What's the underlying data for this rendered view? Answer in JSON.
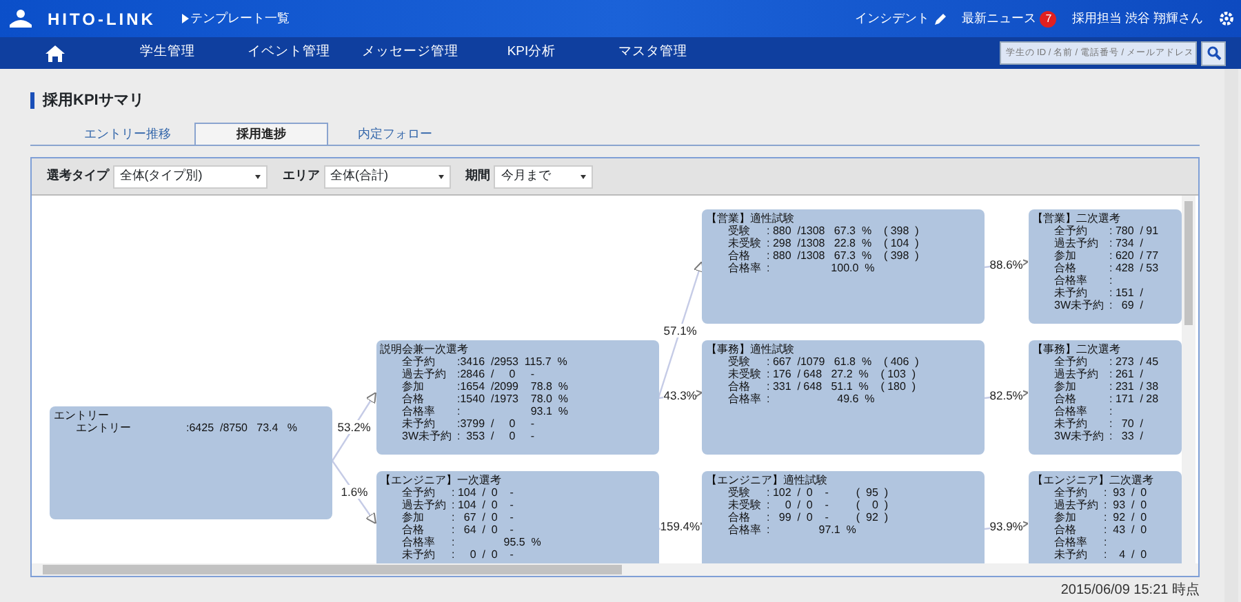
{
  "header": {
    "logo": "HITO-LINK",
    "template_link": "テンプレート一覧",
    "incident": "インシデント",
    "news": "最新ニュース",
    "news_count": "7",
    "user": "採用担当 渋谷 翔輝さん"
  },
  "nav": {
    "items": [
      {
        "label": "学生管理"
      },
      {
        "label": "イベント管理"
      },
      {
        "label": "メッセージ管理"
      },
      {
        "label": "KPI分析"
      },
      {
        "label": "マスタ管理"
      }
    ],
    "search_placeholder": "学生の ID / 名前 / 電話番号 / メールアドレス"
  },
  "page_title": "採用KPIサマリ",
  "tabs": [
    {
      "label": "エントリー推移",
      "selected": false
    },
    {
      "label": "採用進捗",
      "selected": true
    },
    {
      "label": "内定フォロー",
      "selected": false
    }
  ],
  "filters": [
    {
      "label": "選考タイプ",
      "value": "全体(タイプ別)"
    },
    {
      "label": "エリア",
      "value": "全体(合計)"
    },
    {
      "label": "期間",
      "value": "今月まで"
    }
  ],
  "flow": {
    "title": "エントリー",
    "rows": [
      {
        "label": "エントリー",
        "value": ":6425  /8750   73.4   %"
      }
    ],
    "children": [
      {
        "rate": "53.2%",
        "title": "説明会兼一次選考",
        "rows": [
          {
            "label": "全予約",
            "value": ":3416  /2953  115.7  %"
          },
          {
            "label": "過去予約",
            "value": ":2846  /     0     -"
          },
          {
            "label": "参加",
            "value": ":1654  /2099    78.8  %"
          },
          {
            "label": "合格",
            "value": ":1540  /1973    78.0  %"
          },
          {
            "label": "合格率",
            "value": ":                       93.1  %"
          },
          {
            "label": "未予約",
            "value": ":3799  /     0     -"
          },
          {
            "label": "3W未予約",
            "value": ":  353  /     0     -"
          }
        ],
        "children": [
          {
            "rate": "57.1%",
            "title": "【営業】適性試験",
            "rows": [
              {
                "label": "受験",
                "value": ": 880  /1308   67.3  %    ( 398  )"
              },
              {
                "label": "未受験",
                "value": ": 298  /1308   22.8  %    ( 104  )"
              },
              {
                "label": "合格",
                "value": ": 880  /1308   67.3  %    ( 398  )"
              },
              {
                "label": "合格率",
                "value": ":                    100.0  %"
              }
            ],
            "children": [
              {
                "rate": "88.6%",
                "title": "【営業】二次選考",
                "rows": [
                  {
                    "label": "全予約",
                    "value": ": 780  / 91"
                  },
                  {
                    "label": "過去予約",
                    "value": ": 734  /"
                  },
                  {
                    "label": "参加",
                    "value": ": 620  / 77"
                  },
                  {
                    "label": "合格",
                    "value": ": 428  / 53"
                  },
                  {
                    "label": "合格率",
                    "value": ":"
                  },
                  {
                    "label": "未予約",
                    "value": ": 151  /"
                  },
                  {
                    "label": "3W未予約",
                    "value": ":   69  /"
                  }
                ]
              }
            ]
          },
          {
            "rate": "43.3%",
            "title": "【事務】適性試験",
            "rows": [
              {
                "label": "受験",
                "value": ": 667  /1079   61.8  %    ( 406  )"
              },
              {
                "label": "未受験",
                "value": ": 176  / 648   27.2  %    ( 103  )"
              },
              {
                "label": "合格",
                "value": ": 331  / 648   51.1  %    ( 180  )"
              },
              {
                "label": "合格率",
                "value": ":                      49.6  %"
              }
            ],
            "children": [
              {
                "rate": "82.5%",
                "title": "【事務】二次選考",
                "rows": [
                  {
                    "label": "全予約",
                    "value": ": 273  / 45"
                  },
                  {
                    "label": "過去予約",
                    "value": ": 261  /"
                  },
                  {
                    "label": "参加",
                    "value": ": 231  / 38"
                  },
                  {
                    "label": "合格",
                    "value": ": 171  / 28"
                  },
                  {
                    "label": "合格率",
                    "value": ":"
                  },
                  {
                    "label": "未予約",
                    "value": ":   70  /"
                  },
                  {
                    "label": "3W未予約",
                    "value": ":   33  /"
                  }
                ]
              }
            ]
          }
        ]
      },
      {
        "rate": "1.6%",
        "title": "【エンジニア】一次選考",
        "rows": [
          {
            "label": "全予約",
            "value": ": 104  /  0    -"
          },
          {
            "label": "過去予約",
            "value": ": 104  /  0    -"
          },
          {
            "label": "参加",
            "value": ":   67  /  0    -"
          },
          {
            "label": "合格",
            "value": ":   64  /  0    -"
          },
          {
            "label": "合格率",
            "value": ":                95.5  %"
          },
          {
            "label": "未予約",
            "value": ":     0  /  0    -"
          }
        ],
        "children": [
          {
            "rate": "159.4%",
            "title": "【エンジニア】適性試験",
            "rows": [
              {
                "label": "受験",
                "value": ": 102  /  0    -         (  95  )"
              },
              {
                "label": "未受験",
                "value": ":     0  /  0    -         (    0  )"
              },
              {
                "label": "合格",
                "value": ":   99  /  0    -         (  92  )"
              },
              {
                "label": "合格率",
                "value": ":                97.1  %"
              }
            ],
            "children": [
              {
                "rate": "93.9%",
                "title": "【エンジニア】二次選考",
                "rows": [
                  {
                    "label": "全予約",
                    "value": ":  93  /  0"
                  },
                  {
                    "label": "過去予約",
                    "value": ":  93  /  0"
                  },
                  {
                    "label": "参加",
                    "value": ":  92  /  0"
                  },
                  {
                    "label": "合格",
                    "value": ":  43  /  0"
                  },
                  {
                    "label": "合格率",
                    "value": ":"
                  },
                  {
                    "label": "未予約",
                    "value": ":    4  /  0"
                  }
                ]
              }
            ]
          }
        ]
      }
    ]
  },
  "timestamp": "2015/06/09 15:21 時点"
}
